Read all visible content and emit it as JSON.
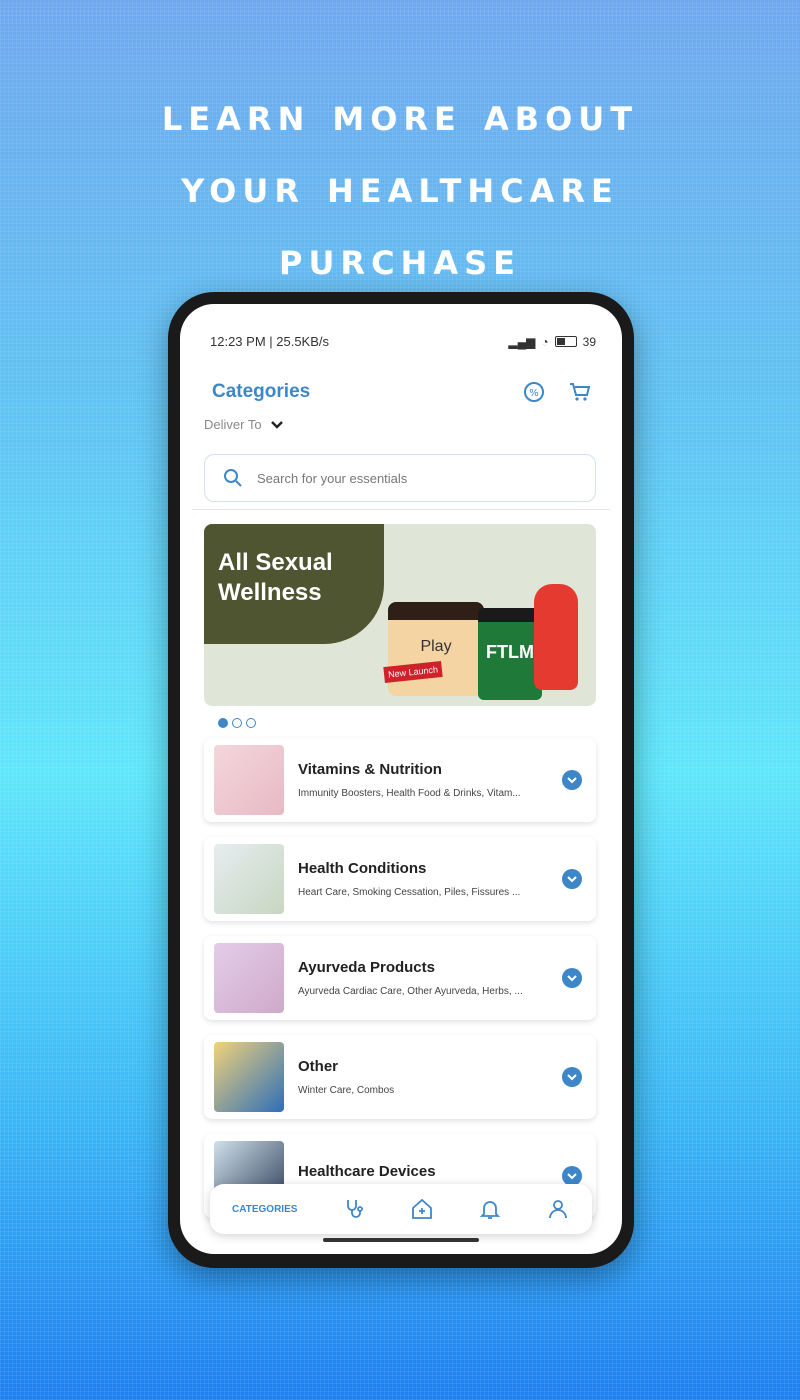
{
  "headline": {
    "line1": "LEARN MORE ABOUT",
    "line2": "YOUR HEALTHCARE",
    "line3": "PURCHASE"
  },
  "status_bar": {
    "left": "12:23 PM | 25.5KB/s",
    "battery": "39"
  },
  "header": {
    "title": "Categories",
    "offer_icon": "discount-icon",
    "cart_icon": "cart-icon"
  },
  "deliver": {
    "label": "Deliver To"
  },
  "search": {
    "placeholder": "Search for your essentials"
  },
  "banner": {
    "title_line1": "All Sexual",
    "title_line2": "Wellness",
    "product1": "Play",
    "tag": "New Launch",
    "product2": "FTLM"
  },
  "carousel": {
    "count": 3,
    "active": 0
  },
  "categories": [
    {
      "name": "Vitamins & Nutrition",
      "sub": "Immunity Boosters, Health Food & Drinks, Vitam...",
      "thumb_color": "#f3d6dc"
    },
    {
      "name": "Health Conditions",
      "sub": "Heart Care, Smoking Cessation, Piles, Fissures ...",
      "thumb_color": "#dfe6ea"
    },
    {
      "name": "Ayurveda Products",
      "sub": "Ayurveda Cardiac Care, Other Ayurveda, Herbs, ...",
      "thumb_color": "#e3cde8"
    },
    {
      "name": "Other",
      "sub": "Winter Care, Combos",
      "thumb_color": "#f2d27a"
    },
    {
      "name": "Healthcare Devices",
      "sub": "",
      "thumb_color": "#cfe0ea"
    }
  ],
  "bottom_nav": {
    "categories_label": "CATEGORIES",
    "items": [
      "stethoscope-icon",
      "home-plus-icon",
      "bell-icon",
      "profile-icon"
    ]
  },
  "colors": {
    "accent": "#3d87c9",
    "banner_dark": "#4f5431"
  }
}
